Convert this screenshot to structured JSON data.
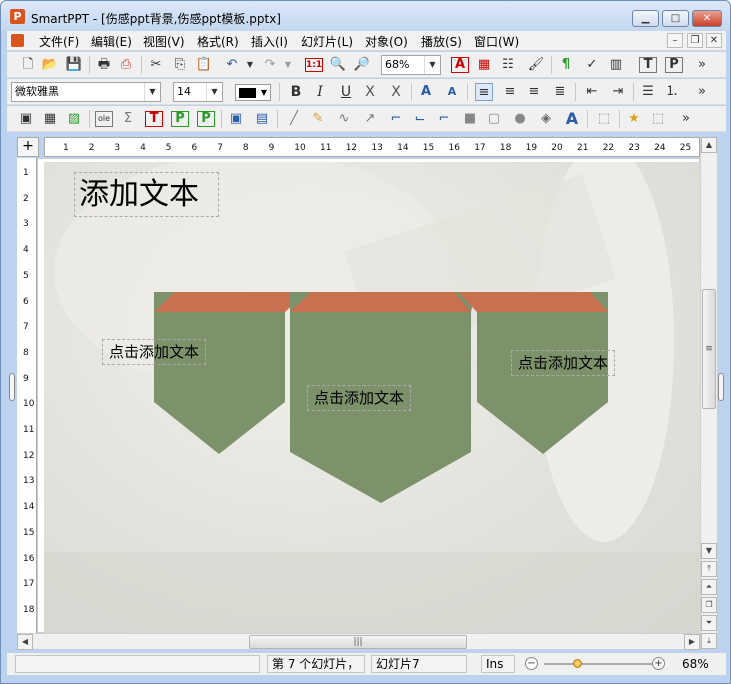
{
  "window": {
    "app_logo": "P",
    "title": "SmartPPT - [伤感ppt背景,伤感ppt模板.pptx]",
    "controls": [
      "minimize-icon",
      "maximize-icon",
      "close-icon"
    ]
  },
  "menu": {
    "items": [
      "文件(F)",
      "编辑(E)",
      "视图(V)",
      "格式(R)",
      "插入(I)",
      "幻灯片(L)",
      "对象(O)",
      "播放(S)",
      "窗口(W)"
    ]
  },
  "toolbar": {
    "zoom": "68%",
    "font_name": "微软雅黑",
    "font_size": "14",
    "text_color": "#000000",
    "page_number_icon": "1:1",
    "bold": "B",
    "italic": "I",
    "underline": "U",
    "strikethrough": "X",
    "shadow": "X",
    "text_a": "A",
    "ole": "ole",
    "big_t": "T",
    "big_p": "P",
    "t_box": "T",
    "p_box": "P",
    "p_icon": "P",
    "more": "»"
  },
  "ruler": {
    "corner": "+",
    "h_numbers": [
      "1",
      "2",
      "3",
      "4",
      "5",
      "6",
      "7",
      "8",
      "9",
      "10",
      "11",
      "12",
      "13",
      "14",
      "15",
      "16",
      "17",
      "18",
      "19",
      "20",
      "21",
      "22",
      "23",
      "24",
      "25"
    ],
    "v_numbers": [
      "1",
      "2",
      "3",
      "4",
      "5",
      "6",
      "7",
      "8",
      "9",
      "10",
      "11",
      "12",
      "13",
      "14",
      "15",
      "16",
      "17",
      "18"
    ]
  },
  "slide": {
    "title": "添加文本",
    "text_left": "点击添加文本",
    "text_center": "点击添加文本",
    "text_right": "点击添加文本",
    "colors": {
      "cap": "#c8704f",
      "body": "#7c926a"
    }
  },
  "status": {
    "slide_index": "第 7 个幻灯片，",
    "slide_name": "幻灯片7",
    "mode": "Ins",
    "zoom": "68%",
    "zoom_minus": "−",
    "zoom_plus": "+"
  },
  "scroll": {
    "grip": "≡",
    "hgrip": "|||"
  }
}
